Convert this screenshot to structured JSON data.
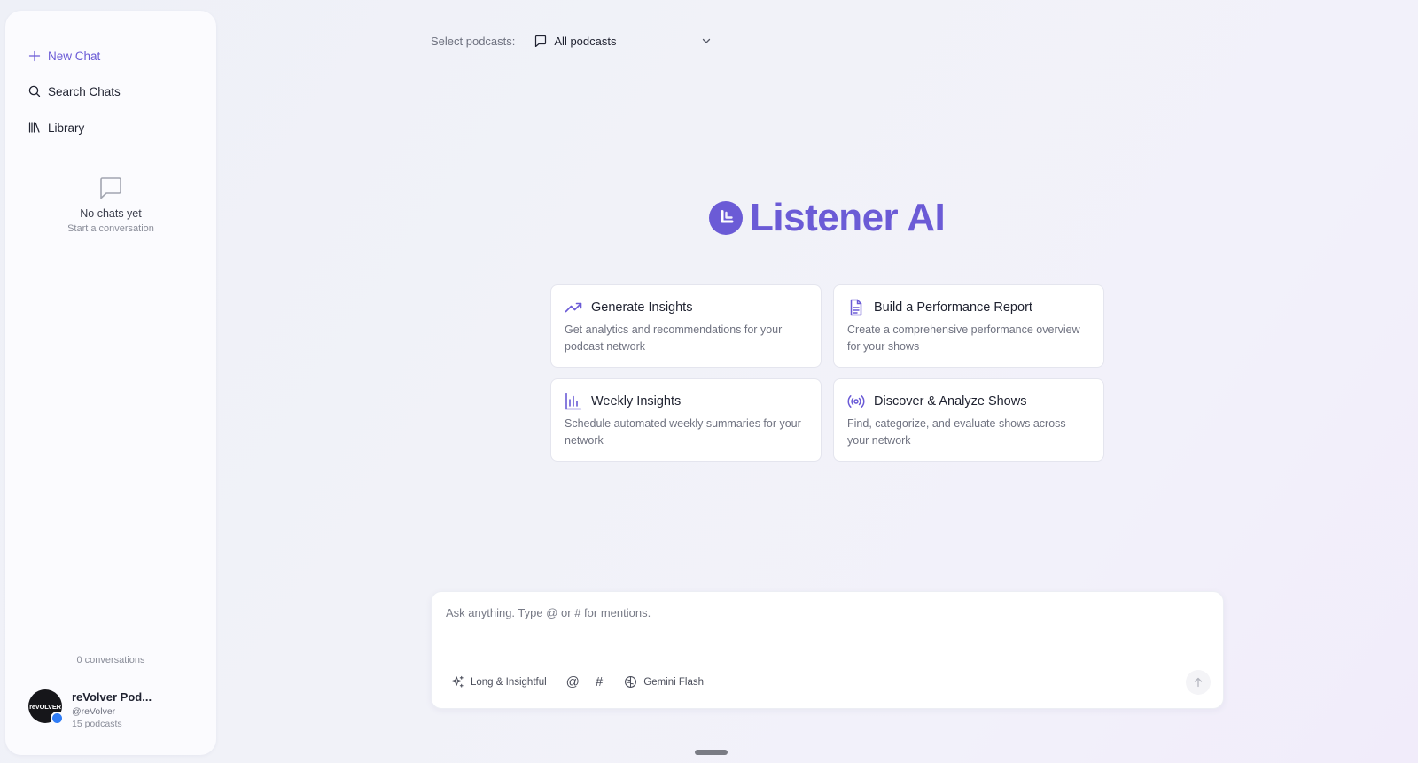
{
  "app": {
    "name": "Listener AI",
    "accent": "#6b5bd6"
  },
  "sidebar": {
    "nav": [
      {
        "label": "New Chat",
        "icon": "plus-icon"
      },
      {
        "label": "Search Chats",
        "icon": "search-icon"
      },
      {
        "label": "Library",
        "icon": "library-icon"
      }
    ],
    "empty_state": {
      "title": "No chats yet",
      "subtitle": "Start a conversation",
      "icon": "chat-bubble-icon"
    },
    "conversation_count": "0 conversations",
    "profile": {
      "name": "reVolver Pod...",
      "handle": "@reVolver",
      "podcast_count": "15 podcasts",
      "avatar_text": "reVOLVER"
    }
  },
  "header": {
    "select_label": "Select podcasts:",
    "select_value": "All podcasts"
  },
  "cards": [
    {
      "title": "Generate Insights",
      "description": "Get analytics and recommendations for your podcast network",
      "icon": "trending-up-icon"
    },
    {
      "title": "Build a Performance Report",
      "description": "Create a comprehensive performance overview for your shows",
      "icon": "document-icon"
    },
    {
      "title": "Weekly Insights",
      "description": "Schedule automated weekly summaries for your network",
      "icon": "bar-chart-icon"
    },
    {
      "title": "Discover & Analyze Shows",
      "description": "Find, categorize, and evaluate shows across your network",
      "icon": "broadcast-icon"
    }
  ],
  "composer": {
    "placeholder": "Ask anything. Type @ or # for mentions.",
    "mode_label": "Long & Insightful",
    "mention_symbol": "@",
    "tag_symbol": "#",
    "model_label": "Gemini Flash"
  }
}
